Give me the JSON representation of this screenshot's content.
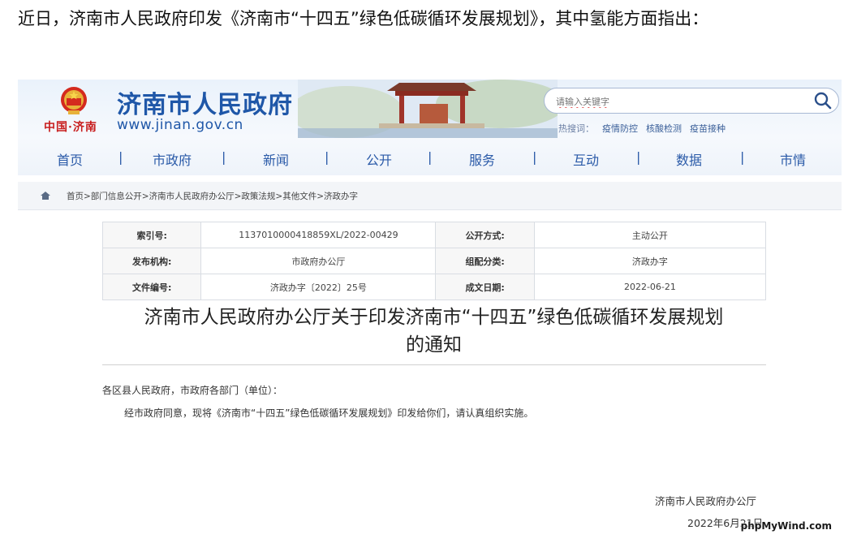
{
  "intro_text": "近日，济南市人民政府印发《济南市“十四五”绿色低碳循环发展规划》，其中氢能方面指出：",
  "header": {
    "site_name": "济南市人民政府",
    "site_url": "www.jinan.gov.cn",
    "china_jinan": "中国·济南",
    "search": {
      "placeholder": "请输入关键字",
      "hot_label": "热搜词：",
      "hot_terms": [
        "疫情防控",
        "核酸检测",
        "疫苗接种"
      ]
    }
  },
  "nav": [
    "首页",
    "市政府",
    "新闻",
    "公开",
    "服务",
    "互动",
    "数据",
    "市情"
  ],
  "breadcrumb": "首页>部门信息公开>济南市人民政府办公厅>政策法规>其他文件>济政办字",
  "meta": {
    "index_no_label": "索引号:",
    "index_no": "1137010000418859XL/2022-00429",
    "open_mode_label": "公开方式:",
    "open_mode": "主动公开",
    "issuer_label": "发布机构:",
    "issuer": "市政府办公厅",
    "category_label": "组配分类:",
    "category": "济政办字",
    "doc_no_label": "文件编号:",
    "doc_no": "济政办字〔2022〕25号",
    "date_label": "成文日期:",
    "date": "2022-06-21"
  },
  "doc": {
    "title_line1": "济南市人民政府办公厅关于印发济南市“十四五”绿色低碳循环发展规划",
    "title_line2": "的通知",
    "salutation": "各区县人民政府，市政府各部门（单位）：",
    "body": "经市政府同意，现将《济南市“十四五”绿色低碳循环发展规划》印发给你们，请认真组织实施。",
    "signature": "济南市人民政府办公厅",
    "sign_date": "2022年6月21日"
  },
  "watermark": "phpMyWind.com",
  "colors": {
    "brand_blue": "#1f57a8",
    "emblem_red": "#c81e1e"
  }
}
